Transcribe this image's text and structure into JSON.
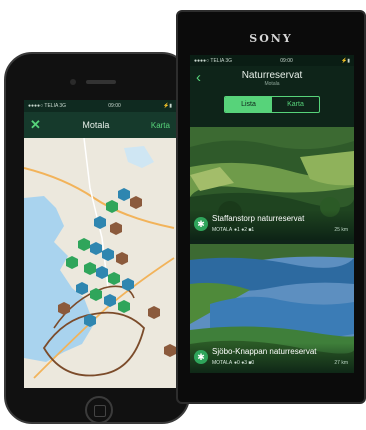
{
  "iphone": {
    "status": {
      "carrier": "●●●●○ TELIA  3G",
      "time": "09:00",
      "battery": "⚡▮"
    },
    "nav": {
      "close_glyph": "✕",
      "title": "Motala",
      "right_label": "Karta"
    }
  },
  "sony": {
    "brand": "SONY",
    "status": {
      "carrier": "●●●●○ TELIA  3G",
      "time": "09:00",
      "battery": "⚡▮"
    },
    "nav": {
      "back_glyph": "‹",
      "title": "Naturreservat",
      "subtitle": "Motala"
    },
    "segmented": {
      "left": "Lista",
      "right": "Karta"
    },
    "cards": [
      {
        "name": "Staffanstorp naturreservat",
        "place": "MOTALA",
        "stats": "●1 ●2 ■1",
        "distance": "25 km",
        "icon": "✱"
      },
      {
        "name": "Sjöbo-Knappan naturreservat",
        "place": "MOTALA",
        "stats": "●0 ●3 ■0",
        "distance": "27 km",
        "icon": "✱"
      }
    ]
  },
  "colors": {
    "accent": "#57d37a",
    "dark_green": "#163a2c",
    "marker_blue": "#2f86b0",
    "marker_green": "#2fa55b",
    "marker_brown": "#8b5a3c"
  }
}
